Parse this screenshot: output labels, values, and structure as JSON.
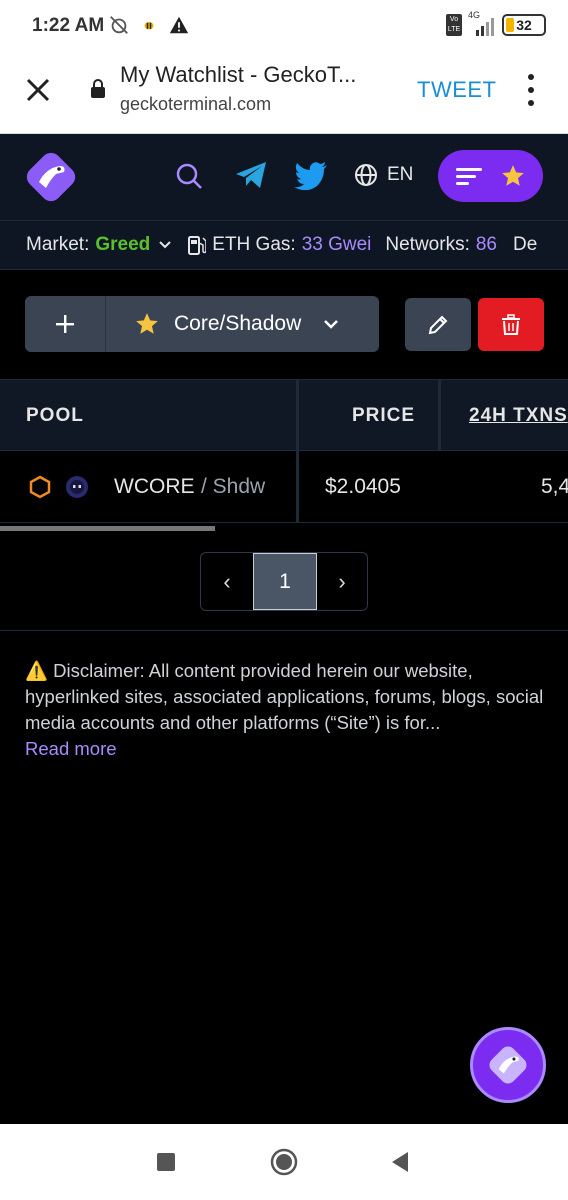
{
  "status_bar": {
    "time": "1:22 AM",
    "network": "4G",
    "volte": "Vo LTE",
    "battery": "32"
  },
  "browser": {
    "title": "My Watchlist - GeckoT...",
    "url": "geckoterminal.com",
    "tweet_label": "TWEET"
  },
  "header": {
    "language": "EN"
  },
  "market": {
    "market_label": "Market:",
    "market_value": "Greed",
    "gas_label": "ETH Gas:",
    "gas_value": "33 Gwei",
    "networks_label": "Networks:",
    "networks_value": "86",
    "overflow_text": "De"
  },
  "watchlist": {
    "add_label": "+",
    "selected_list": "Core/Shadow"
  },
  "table": {
    "columns": [
      "POOL",
      "PRICE",
      "24H TXNS"
    ],
    "rows": [
      {
        "base": "WCORE",
        "quote": "/ Shdw",
        "price": "$2.0405",
        "txns": "5,4"
      }
    ]
  },
  "pagination": {
    "prev": "‹",
    "current": "1",
    "next": "›"
  },
  "disclaimer": {
    "text": "⚠️ Disclaimer: All content provided herein our website, hyperlinked sites, associated applications, forums, blogs, social media accounts and other platforms (“Site”) is for...",
    "read_more": "Read more"
  },
  "colors": {
    "accent_purple": "#7b2cf0",
    "greed_green": "#5cc02c",
    "delete_red": "#e31b23",
    "header_bg": "#0d1622"
  }
}
